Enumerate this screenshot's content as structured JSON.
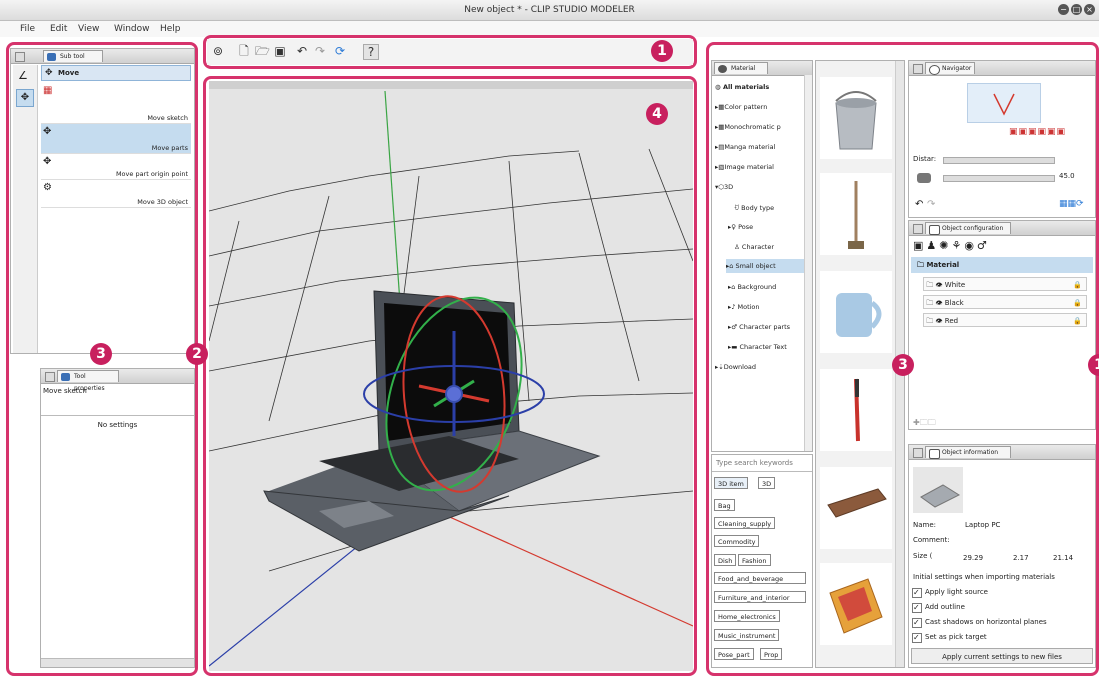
{
  "window": {
    "title": "New object * - CLIP STUDIO MODELER",
    "controls": [
      "−",
      "□",
      "×"
    ]
  },
  "menu": [
    "File",
    "Edit",
    "View",
    "Window",
    "Help"
  ],
  "badges": {
    "b1": "1",
    "b2": "2",
    "b3": "3",
    "b4": "4"
  },
  "subtool": {
    "tab_label": "Sub tool",
    "header": "Move",
    "items": [
      "Move sketch",
      "Move parts",
      "Move part origin point",
      "Move 3D object"
    ]
  },
  "tool_properties": {
    "tab_label": "Tool properties",
    "name": "Move sketch",
    "empty": "No settings"
  },
  "material": {
    "tab_label": "Material",
    "tree": [
      "All materials",
      "Color pattern",
      "Monochromatic p",
      "Manga material",
      "Image material",
      "3D",
      "Body type",
      "Pose",
      "Character",
      "Small object",
      "Background",
      "Motion",
      "Character parts",
      "Character Text",
      "Download"
    ],
    "search_placeholder": "Type search keywords",
    "tags": [
      "3D item",
      "3D",
      "Bag",
      "Cleaning_supply",
      "Commodity",
      "Dish",
      "Fashion",
      "Food_and_beverage",
      "Furniture_and_interior",
      "Home_electronics",
      "Music_instrument",
      "Pose_part",
      "Prop"
    ]
  },
  "navigator": {
    "tab_label": "Navigator",
    "distance_label": "Distar:",
    "angle_value": "45.0"
  },
  "object_configuration": {
    "tab_label": "Object configuration",
    "root": "Material",
    "layers": [
      "White",
      "Black",
      "Red"
    ]
  },
  "object_information": {
    "tab_label": "Object information",
    "name_label": "Name:",
    "name_value": "Laptop PC",
    "comment_label": "Comment:",
    "size_label": "Size  (",
    "size_values": [
      "29.29",
      "2.17",
      "21.14"
    ],
    "import_heading": "Initial settings when importing materials",
    "options": [
      "Apply light source",
      "Add outline",
      "Cast shadows on horizontal planes",
      "Set as pick target"
    ],
    "apply_button": "Apply current settings to new files"
  },
  "colors": {
    "accent": "#d6336c",
    "badge": "#c8205e",
    "selection": "#c5dcef"
  }
}
